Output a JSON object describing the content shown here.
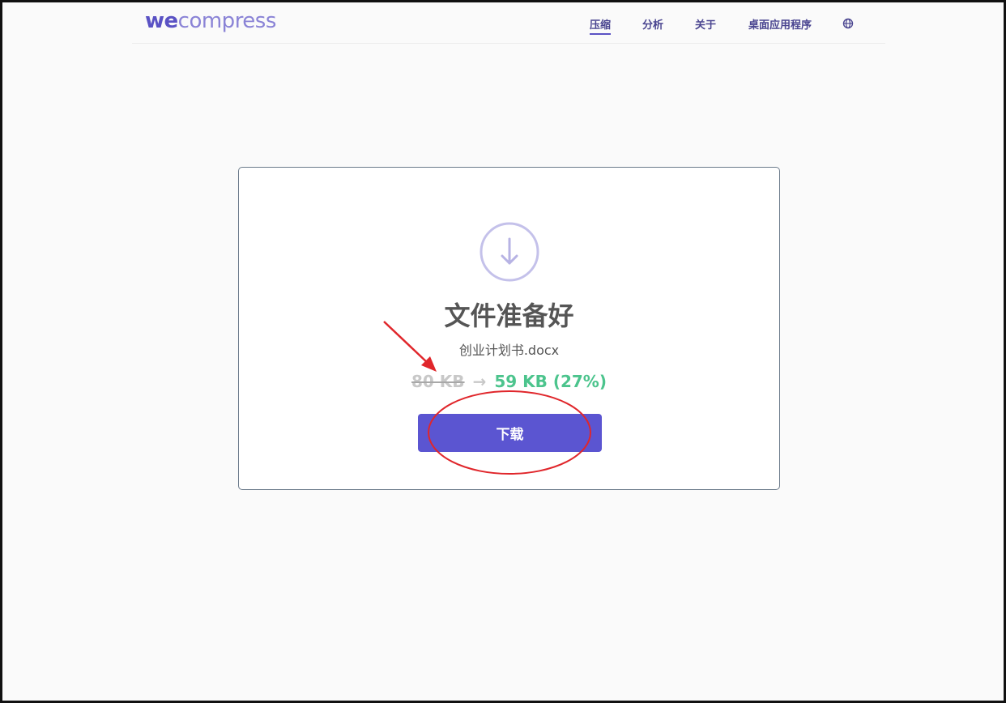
{
  "header": {
    "logo_we": "we",
    "logo_rest": "compress",
    "nav": [
      {
        "label": "压缩",
        "active": true
      },
      {
        "label": "分析",
        "active": false
      },
      {
        "label": "关于",
        "active": false
      },
      {
        "label": "桌面应用程序",
        "active": false
      }
    ],
    "language_icon": "globe-icon"
  },
  "result": {
    "icon": "download-arrow-circle-icon",
    "title": "文件准备好",
    "filename": "创业计划书.docx",
    "original_size": "80 KB",
    "arrow": "→",
    "compressed_size": "59 KB (27%)",
    "download_label": "下载"
  },
  "colors": {
    "accent": "#5b55d1",
    "success": "#4cc48d",
    "annotation": "#e0262b"
  }
}
